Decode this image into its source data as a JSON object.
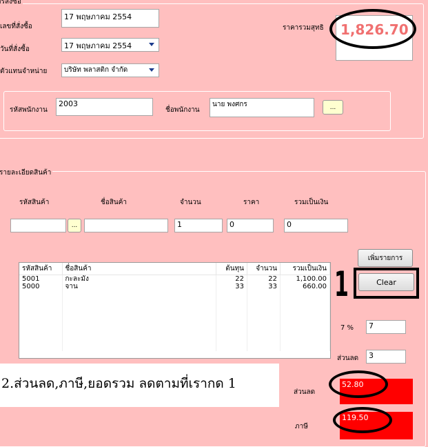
{
  "order_group": {
    "title": "การสั่งซื้อ",
    "order_no_label": "เลขที่สั่งซื้อ",
    "order_no_value": "17 พฤษภาคม 2554",
    "order_date_label": "วันที่สั่งซื้อ",
    "order_date_value": "17  พฤษภาคม   2554",
    "dealer_label": "ตัวแทนจำหน่าย",
    "dealer_value": "บริษัท พลาสติก จำกัด",
    "total_label": "ราคารวมสุทธิ",
    "total_value": "1,826.70",
    "employee_id_label": "รหัสพนักงาน",
    "employee_id_value": "2003",
    "employee_name_label": "ชื่อพนักงาน",
    "employee_name_value": "นาย พงศกร",
    "browse_label": "..."
  },
  "detail_group": {
    "title": "รายละเอียดสินค้า",
    "headers": [
      "รหัสสินค้า",
      "ชื่อสินค้า",
      "จำนวน",
      "ราคา",
      "รวมเป็นเงิน"
    ],
    "inputs": {
      "code": "",
      "browse": "...",
      "name": "",
      "qty": "1",
      "price": "0",
      "sum": "0"
    },
    "add_button": "เพิ่มรายการ",
    "clear_button": "Clear",
    "list_columns": [
      "รหัสสินค้า",
      "ชื่อสินค้า",
      "ต้นทุน",
      "จำนวน",
      "รวมเป็นเงิน"
    ],
    "list_rows": [
      [
        "5001",
        "กะละมัง",
        "22",
        "22",
        "1,100.00"
      ],
      [
        "5000",
        "จาน",
        "33",
        "33",
        "660.00"
      ]
    ],
    "vat_label": "7 %",
    "vat_value": "7",
    "discount_input_label": "ส่วนลด",
    "discount_input_value": "3",
    "discount_label": "ส่วนลด",
    "discount_value": "52.80",
    "tax_label": "ภาษี",
    "tax_value": "119.50"
  },
  "annotations": {
    "step_number": "1",
    "note": "2.ส่วนลด,ภาษี,ยอดรวม ลดตามที่เรากด 1"
  },
  "colors": {
    "background": "#ffbfbf",
    "total_text": "#f07070",
    "highlight_box": "#ff0000"
  }
}
